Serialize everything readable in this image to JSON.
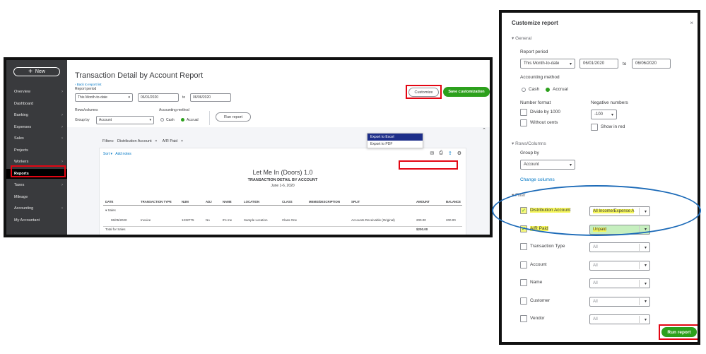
{
  "sidebar": {
    "new_label": "New",
    "items": [
      {
        "label": "Overview",
        "chevron": true
      },
      {
        "label": "Dashboard",
        "chevron": false
      },
      {
        "label": "Banking",
        "chevron": true
      },
      {
        "label": "Expenses",
        "chevron": true
      },
      {
        "label": "Sales",
        "chevron": true
      },
      {
        "label": "Projects",
        "chevron": false
      },
      {
        "label": "Workers",
        "chevron": true
      },
      {
        "label": "Reports",
        "chevron": false
      },
      {
        "label": "Taxes",
        "chevron": true
      },
      {
        "label": "Mileage",
        "chevron": false
      },
      {
        "label": "Accounting",
        "chevron": true
      },
      {
        "label": "My Accountant",
        "chevron": false
      }
    ]
  },
  "report": {
    "title": "Transaction Detail by Account Report",
    "back_link": "Back to report list",
    "report_period_label": "Report period",
    "period": "This Month-to-date",
    "from": "06/01/2020",
    "to_label": "to",
    "to": "06/06/2020",
    "rows_columns_label": "Rows/columns",
    "group_by_label": "Group by",
    "group_by": "Account",
    "accounting_method_label": "Accounting method",
    "cash_label": "Cash",
    "accrual_label": "Accrual",
    "run_report": "Run report",
    "customize": "Customize",
    "save_customization": "Save customization",
    "filters_label": "Filters:",
    "filter_chips": [
      "Distribution Account",
      "A/R Paid"
    ],
    "sort_label": "Sort",
    "add_notes": "Add notes",
    "export_menu": [
      "Export to Excel",
      "Export to PDF"
    ],
    "company": "Let Me In (Doors) 1.0",
    "report_heading": "TRANSACTION DETAIL BY ACCOUNT",
    "dates": "June 1-6, 2020",
    "columns": [
      "DATE",
      "TRANSACTION TYPE",
      "NUM",
      "ADJ",
      "NAME",
      "LOCATION",
      "CLASS",
      "MEMO/DESCRIPTION",
      "SPLIT",
      "AMOUNT",
      "BALANCE"
    ],
    "group_label": "Sales",
    "row": [
      "06/05/2020",
      "Invoice",
      "1232775",
      "No",
      "It's me",
      "Sample Location",
      "Class One",
      "",
      "Accounts Receivable (Original)",
      "200.00",
      "200.00"
    ],
    "total_label": "Total for Sales",
    "total_value": "$200.00"
  },
  "panel": {
    "title": "Customize report",
    "close": "×",
    "general": "General",
    "report_period_label": "Report period",
    "period": "This Month-to-date",
    "from": "06/01/2020",
    "to_label": "to",
    "to": "06/06/2020",
    "accounting_method": "Accounting method",
    "cash": "Cash",
    "accrual": "Accrual",
    "number_format": "Number format",
    "divide_by_1000": "Divide by 1000",
    "without_cents": "Without cents",
    "negative_numbers": "Negative numbers",
    "negative_format": "-100",
    "show_in_red": "Show in red",
    "rows_columns": "Rows/Columns",
    "group_by_label": "Group by",
    "group_by": "Account",
    "change_columns": "Change columns",
    "filter": "Filter",
    "filters": [
      {
        "label": "Distribution Account",
        "checked": true,
        "value": "All Income/Expense A"
      },
      {
        "label": "A/R Paid",
        "checked": true,
        "value": "Unpaid"
      },
      {
        "label": "Transaction Type",
        "checked": false,
        "value": "All"
      },
      {
        "label": "Account",
        "checked": false,
        "value": "All"
      },
      {
        "label": "Name",
        "checked": false,
        "value": "All"
      },
      {
        "label": "Customer",
        "checked": false,
        "value": "All"
      },
      {
        "label": "Vendor",
        "checked": false,
        "value": "All"
      }
    ],
    "run_report": "Run report"
  },
  "colors": {
    "sidebar": "#393a3d",
    "green": "#2ca01c",
    "link": "#0077c5",
    "highlight_red": "#e30613",
    "ellipse": "#1d6bb8"
  }
}
